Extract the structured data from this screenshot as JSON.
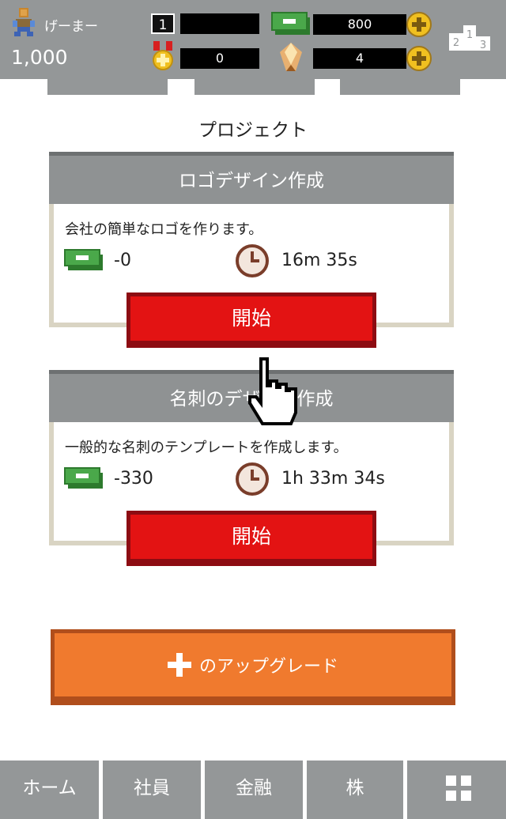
{
  "header": {
    "username": "げーまー",
    "money": "1,000",
    "rank": "1",
    "rank_bar": "",
    "cash": "800",
    "medals": "0",
    "gems": "4",
    "podium_labels": [
      "2",
      "1",
      "3"
    ]
  },
  "section_title": "プロジェクト",
  "projects": [
    {
      "title": "ロゴデザイン作成",
      "description": "会社の簡単なロゴを作ります。",
      "cost": "-0",
      "time": "16m 35s",
      "start_label": "開始"
    },
    {
      "title": "名刺のデザイン作成",
      "description": "一般的な名刺のテンプレートを作成します。",
      "cost": "-330",
      "time": "1h 33m 34s",
      "start_label": "開始"
    }
  ],
  "upgrade_label": "のアップグレード",
  "nav": [
    {
      "label": "ホーム"
    },
    {
      "label": "社員"
    },
    {
      "label": "金融"
    },
    {
      "label": "株"
    }
  ],
  "colors": {
    "header_bg": "#949798",
    "start_button": "#e31313",
    "upgrade_button": "#f07a2e",
    "card_outline": "#d9d4c3"
  },
  "icons": [
    "person-icon",
    "cash-icon",
    "coin-plus-icon",
    "medal-icon",
    "gem-icon",
    "podium-icon",
    "clock-icon",
    "plus-icon",
    "grid-icon",
    "hand-cursor-icon"
  ]
}
